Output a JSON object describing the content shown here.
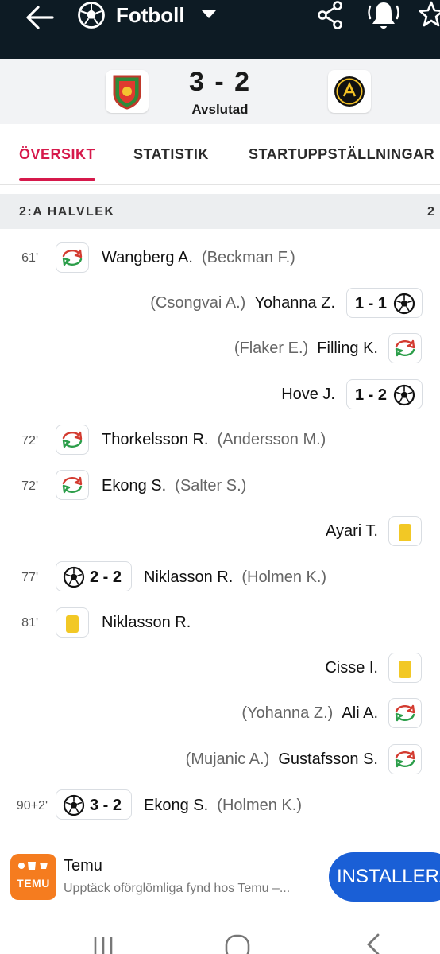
{
  "header": {
    "title": "Fotboll",
    "icons": [
      "back-arrow-icon",
      "soccer-ball-icon",
      "dropdown-caret-icon",
      "share-icon",
      "notification-bell-icon",
      "favorite-star-icon"
    ]
  },
  "match": {
    "score": "3 - 2",
    "status": "Avslutad",
    "home_badge": "home-team-badge",
    "away_badge": "away-team-badge"
  },
  "tabs": [
    {
      "label": "ÖVERSIKT",
      "active": true
    },
    {
      "label": "STATISTIK",
      "active": false
    },
    {
      "label": "STARTUPPSTÄLLNINGAR",
      "active": false
    }
  ],
  "section": {
    "label": "2:A HALVLEK",
    "value": "2"
  },
  "events": [
    {
      "minute": "61'",
      "side": "home",
      "type": "substitution",
      "player": "Wangberg A.",
      "assist": "(Beckman F.)"
    },
    {
      "minute": "",
      "side": "away",
      "type": "goal",
      "score": "1 - 1",
      "player": "Yohanna Z.",
      "assist": "(Csongvai A.)"
    },
    {
      "minute": "",
      "side": "away",
      "type": "substitution",
      "player": "Filling K.",
      "assist": "(Flaker E.)"
    },
    {
      "minute": "",
      "side": "away",
      "type": "goal",
      "score": "1 - 2",
      "player": "Hove J.",
      "assist": ""
    },
    {
      "minute": "72'",
      "side": "home",
      "type": "substitution",
      "player": "Thorkelsson R.",
      "assist": "(Andersson M.)"
    },
    {
      "minute": "72'",
      "side": "home",
      "type": "substitution",
      "player": "Ekong S.",
      "assist": "(Salter S.)"
    },
    {
      "minute": "",
      "side": "away",
      "type": "yellow-card",
      "player": "Ayari T.",
      "assist": ""
    },
    {
      "minute": "77'",
      "side": "home",
      "type": "goal",
      "score": "2 - 2",
      "player": "Niklasson R.",
      "assist": "(Holmen K.)"
    },
    {
      "minute": "81'",
      "side": "home",
      "type": "yellow-card",
      "player": "Niklasson R.",
      "assist": ""
    },
    {
      "minute": "",
      "side": "away",
      "type": "yellow-card",
      "player": "Cisse I.",
      "assist": ""
    },
    {
      "minute": "",
      "side": "away",
      "type": "substitution",
      "player": "Ali A.",
      "assist": "(Yohanna Z.)"
    },
    {
      "minute": "",
      "side": "away",
      "type": "substitution",
      "player": "Gustafsson S.",
      "assist": "(Mujanic A.)"
    },
    {
      "minute": "90+2'",
      "side": "home",
      "type": "goal",
      "score": "3 - 2",
      "player": "Ekong S.",
      "assist": "(Holmen K.)"
    }
  ],
  "ad": {
    "logo_text": "TEMU",
    "title": "Temu",
    "subtitle": "Upptäck oförglömliga fynd hos Temu –...",
    "button": "INSTALLERA"
  },
  "navbar": {
    "icons": [
      "recent-apps-icon",
      "home-icon",
      "back-icon"
    ]
  },
  "colors": {
    "accent": "#d6194b",
    "header_bg": "#0d1b24",
    "install_button": "#1a5fd6",
    "yellow_card": "#f2c825",
    "temu_orange": "#f57c1f"
  }
}
